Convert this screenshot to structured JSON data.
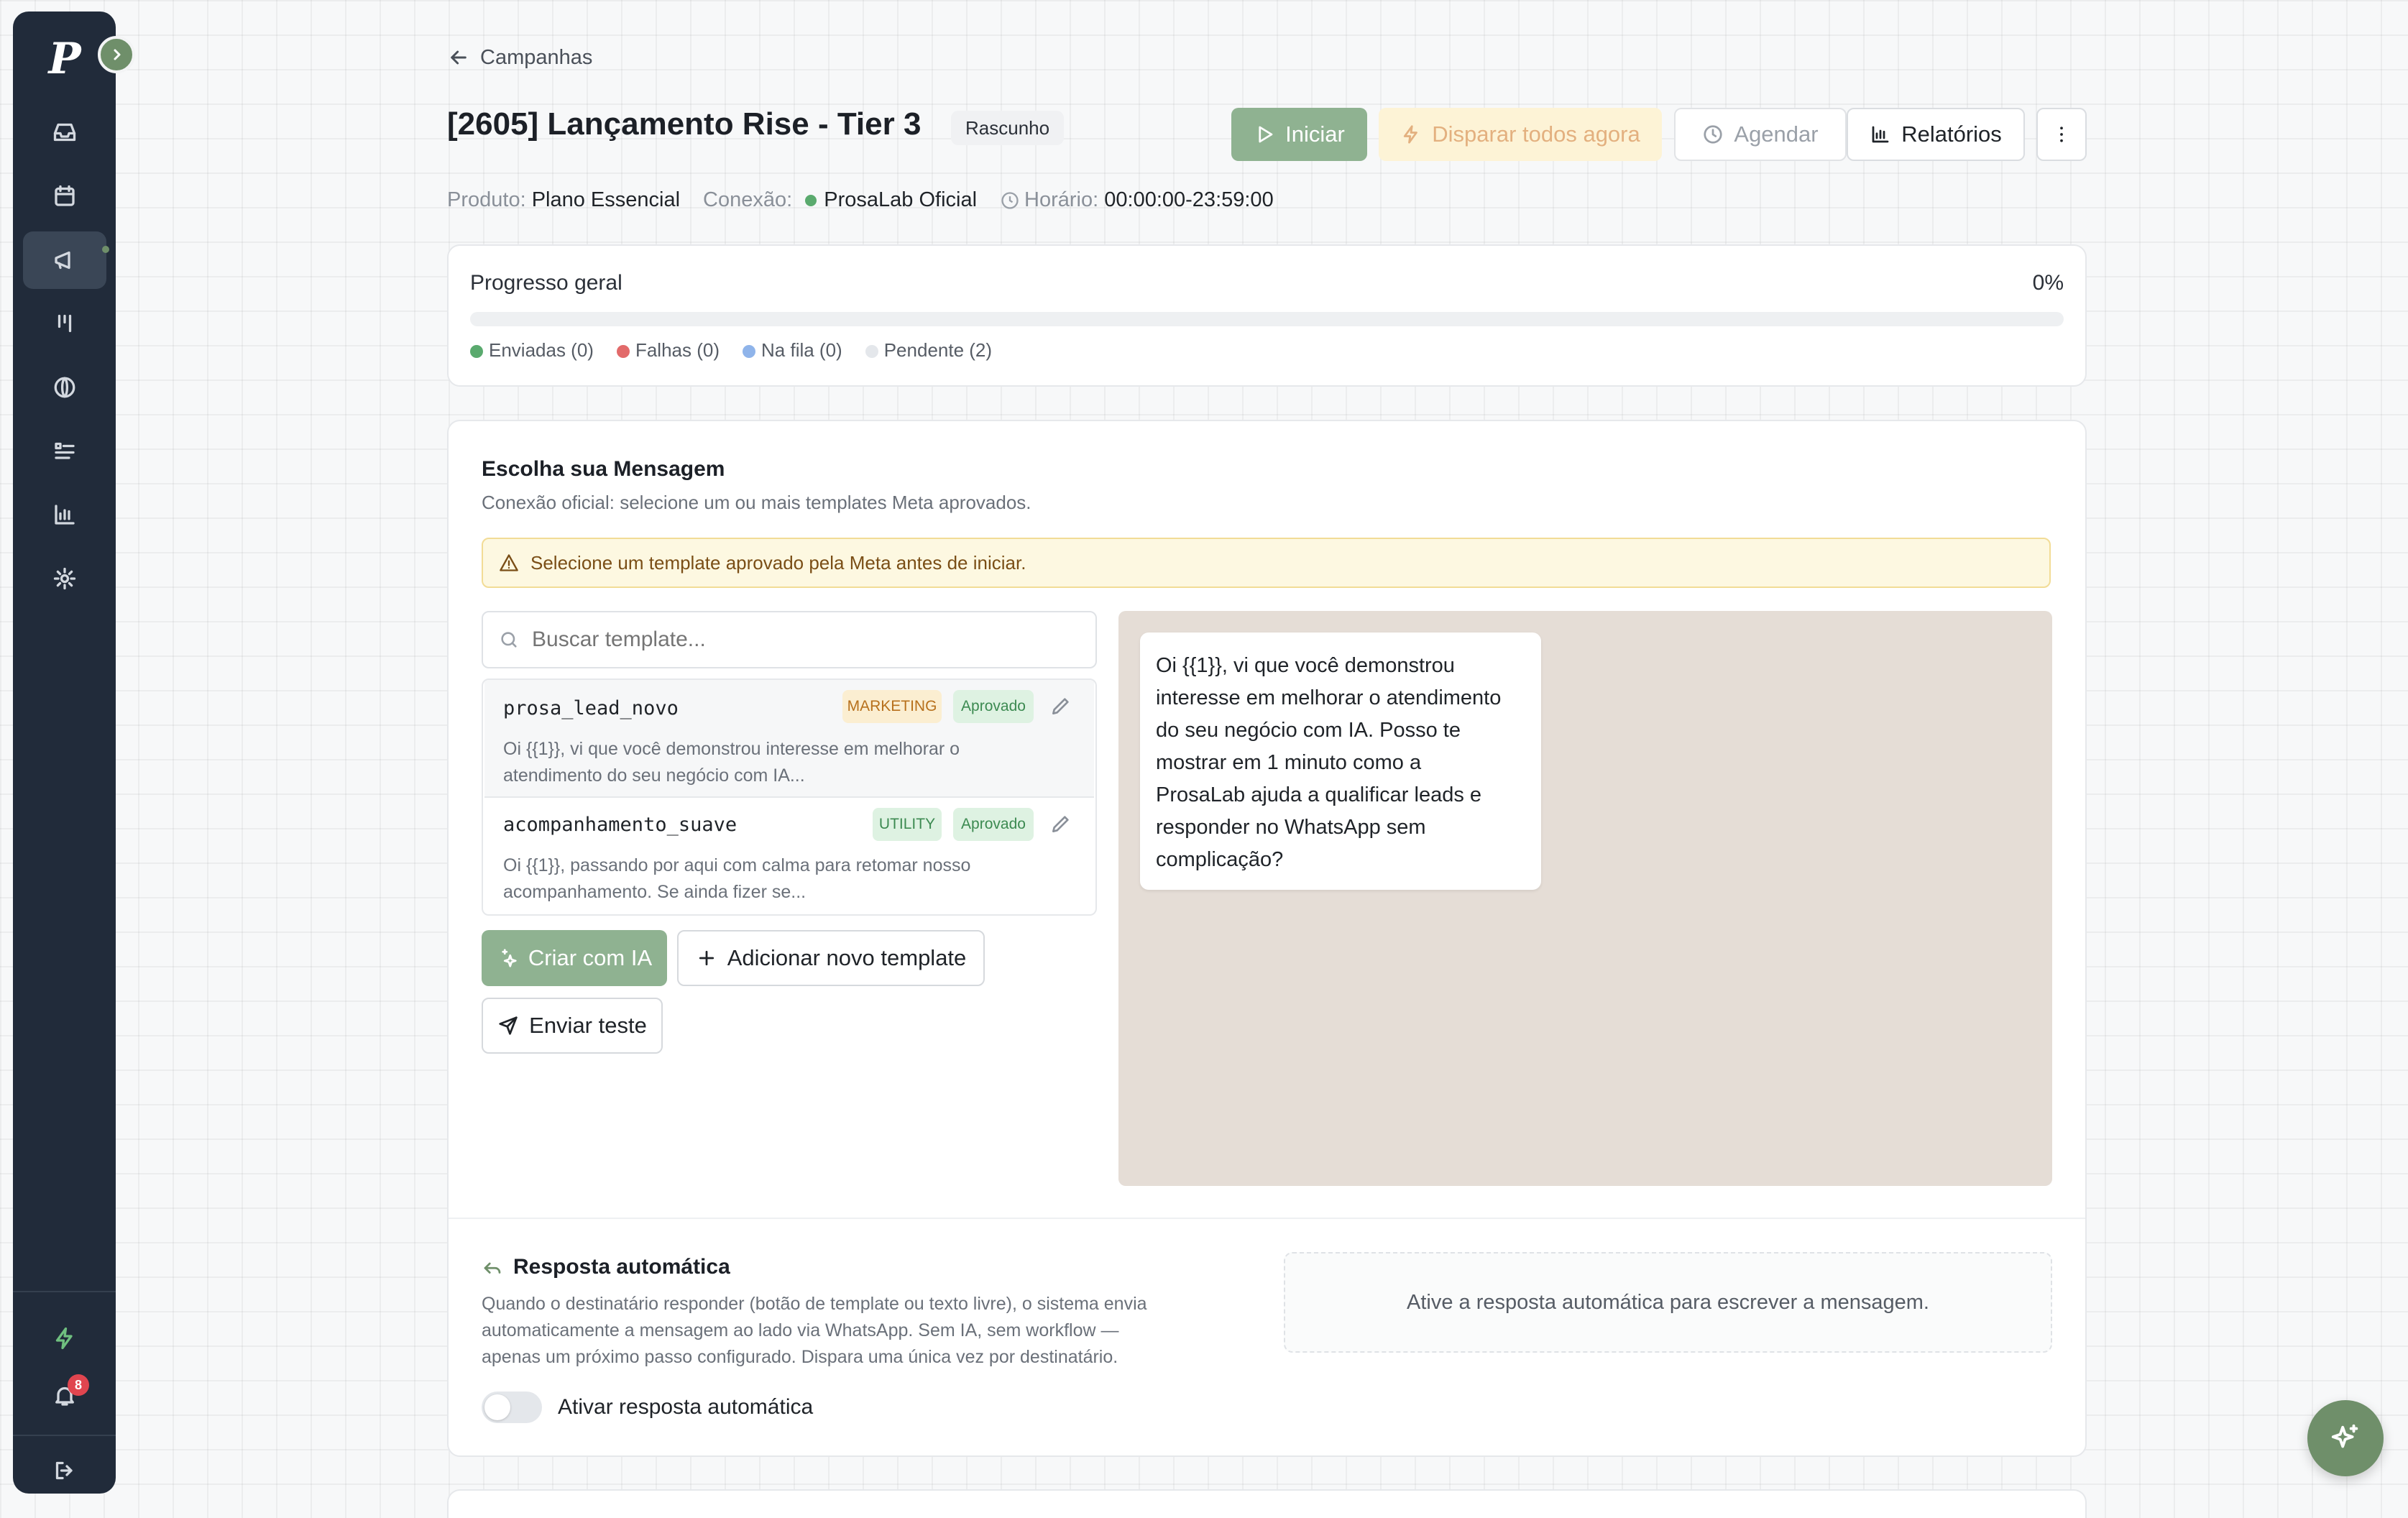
{
  "sidebar": {
    "logo": "P",
    "notification_count": "8",
    "items": [
      "inbox",
      "calendar",
      "campaigns",
      "pipeline",
      "contacts",
      "tasks",
      "reports",
      "settings"
    ]
  },
  "header": {
    "back_label": "Campanhas",
    "title": "[2605] Lançamento Rise - Tier 3",
    "status": "Rascunho",
    "buttons": {
      "start": "Iniciar",
      "fire_all": "Disparar todos agora",
      "schedule": "Agendar",
      "reports": "Relatórios"
    },
    "meta": {
      "product_label": "Produto:",
      "product_value": "Plano Essencial",
      "connection_label": "Conexão:",
      "connection_value": "ProsaLab Oficial",
      "time_label": "Horário:",
      "time_value": "00:00:00-23:59:00"
    }
  },
  "progress": {
    "title": "Progresso geral",
    "percent_label": "0%",
    "percent": 0,
    "legend": [
      {
        "label": "Enviadas (0)",
        "color": "#5aaa6e"
      },
      {
        "label": "Falhas (0)",
        "color": "#e26a6a"
      },
      {
        "label": "Na fila (0)",
        "color": "#8fb4ea"
      },
      {
        "label": "Pendente (2)",
        "color": "#e4e7eb"
      }
    ]
  },
  "message": {
    "title": "Escolha sua Mensagem",
    "subtitle": "Conexão oficial: selecione um ou mais templates Meta aprovados.",
    "warning": "Selecione um template aprovado pela Meta antes de iniciar.",
    "search_placeholder": "Buscar template...",
    "templates": [
      {
        "name": "prosa_lead_novo",
        "category": "MARKETING",
        "status": "Aprovado",
        "preview_line1": "Oi {{1}}, vi que você demonstrou interesse em melhorar o",
        "preview_line2": "atendimento do seu negócio com IA..."
      },
      {
        "name": "acompanhamento_suave",
        "category": "UTILITY",
        "status": "Aprovado",
        "preview_line1": "Oi {{1}}, passando por aqui com calma para retomar nosso",
        "preview_line2": "acompanhamento. Se ainda fizer se..."
      }
    ],
    "create_ai": "Criar com IA",
    "add_template": "Adicionar novo template",
    "send_test": "Enviar teste",
    "bubble_lines": [
      "Oi {{1}}, vi que você demonstrou",
      "interesse em melhorar o atendimento",
      "do seu negócio com IA. Posso te",
      "mostrar em 1 minuto como a",
      "ProsaLab ajuda a qualificar leads e",
      "responder no WhatsApp sem",
      "complicação?"
    ]
  },
  "auto_reply": {
    "title": "Resposta automática",
    "desc_line1": "Quando o destinatário responder (botão de template ou texto livre), o sistema envia",
    "desc_line2": "automaticamente a mensagem ao lado via WhatsApp. Sem IA, sem workflow —",
    "desc_line3": "apenas um próximo passo configurado. Dispara uma única vez por destinatário.",
    "toggle_label": "Ativar resposta automática",
    "toggle_on": false,
    "placeholder": "Ative a resposta automática para escrever a mensagem."
  },
  "colors": {
    "accent": "#6f8f6a",
    "sidebar": "#212b3a",
    "warning_bg": "#fdf8e1",
    "preview_bg": "#e5ddd6"
  }
}
